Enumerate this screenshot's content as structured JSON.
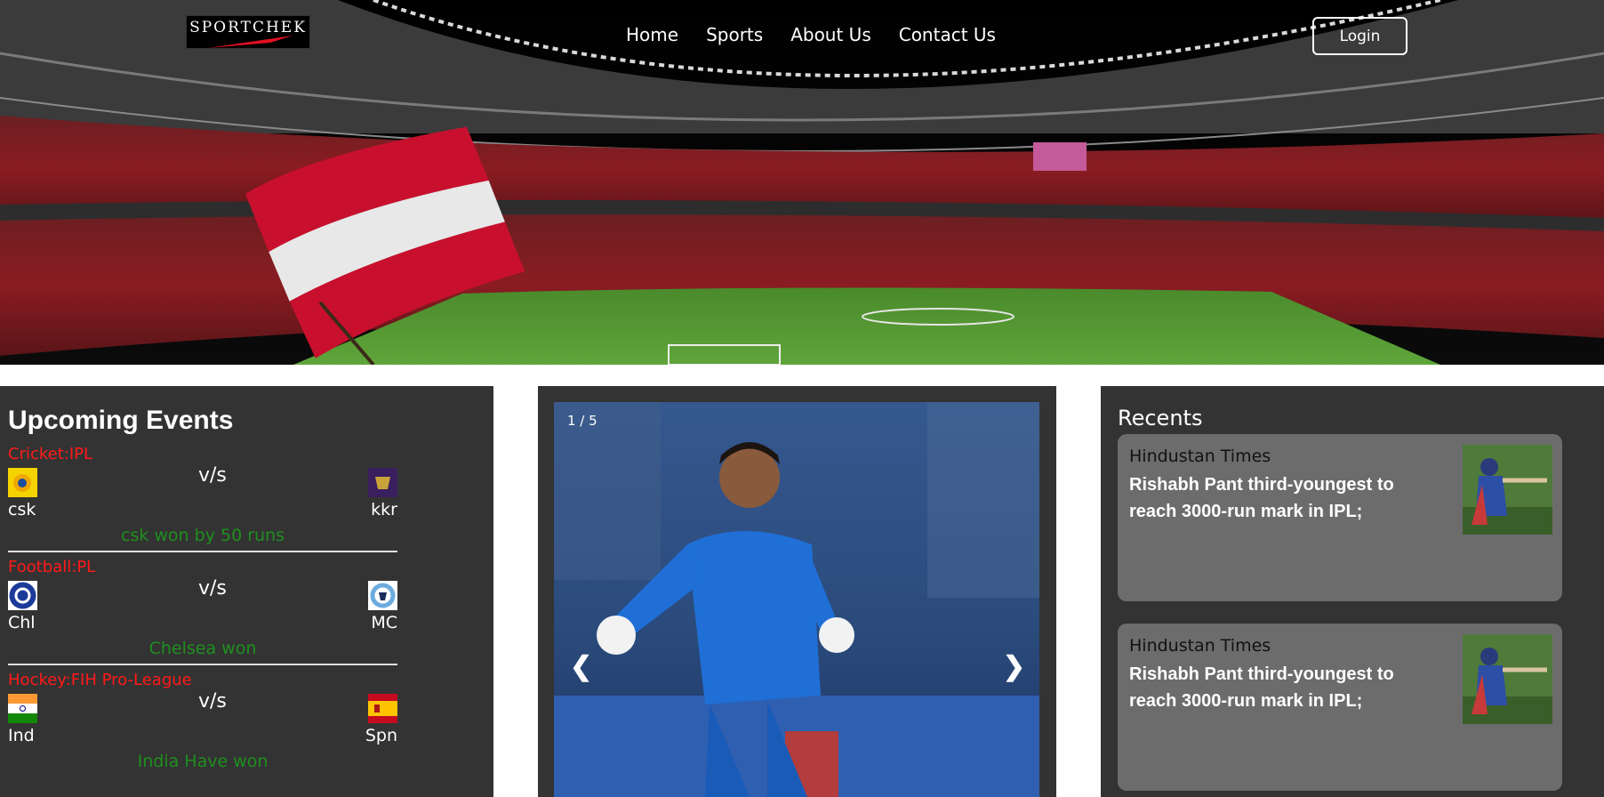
{
  "header": {
    "logo_text": "SPORTCHEK",
    "nav": [
      "Home",
      "Sports",
      "About Us",
      "Contact Us"
    ],
    "login_label": "Login"
  },
  "events": {
    "title": "Upcoming Events",
    "items": [
      {
        "category": "Cricket:IPL",
        "team1": "csk",
        "team2": "kkr",
        "vs": "v/s",
        "result": "csk won by 50 runs"
      },
      {
        "category": "Football:PL",
        "team1": "Chl",
        "team2": "MC",
        "vs": "v/s",
        "result": "Chelsea won"
      },
      {
        "category": "Hockey:FIH Pro-League",
        "team1": "Ind",
        "team2": "Spn",
        "vs": "v/s",
        "result": "India Have won"
      }
    ]
  },
  "carousel": {
    "counter": "1 / 5",
    "prev": "❮",
    "next": "❯"
  },
  "recents": {
    "title": "Recents",
    "cards": [
      {
        "source": "Hindustan Times",
        "headline": "Rishabh Pant third-youngest to reach 3000-run mark in IPL;"
      },
      {
        "source": "Hindustan Times",
        "headline": "Rishabh Pant third-youngest to reach 3000-run mark in IPL;"
      }
    ]
  },
  "colors": {
    "panel_bg": "#333333",
    "category": "#ff1a1a",
    "result": "#1f8f1f",
    "card_bg": "#6c6c6c"
  }
}
